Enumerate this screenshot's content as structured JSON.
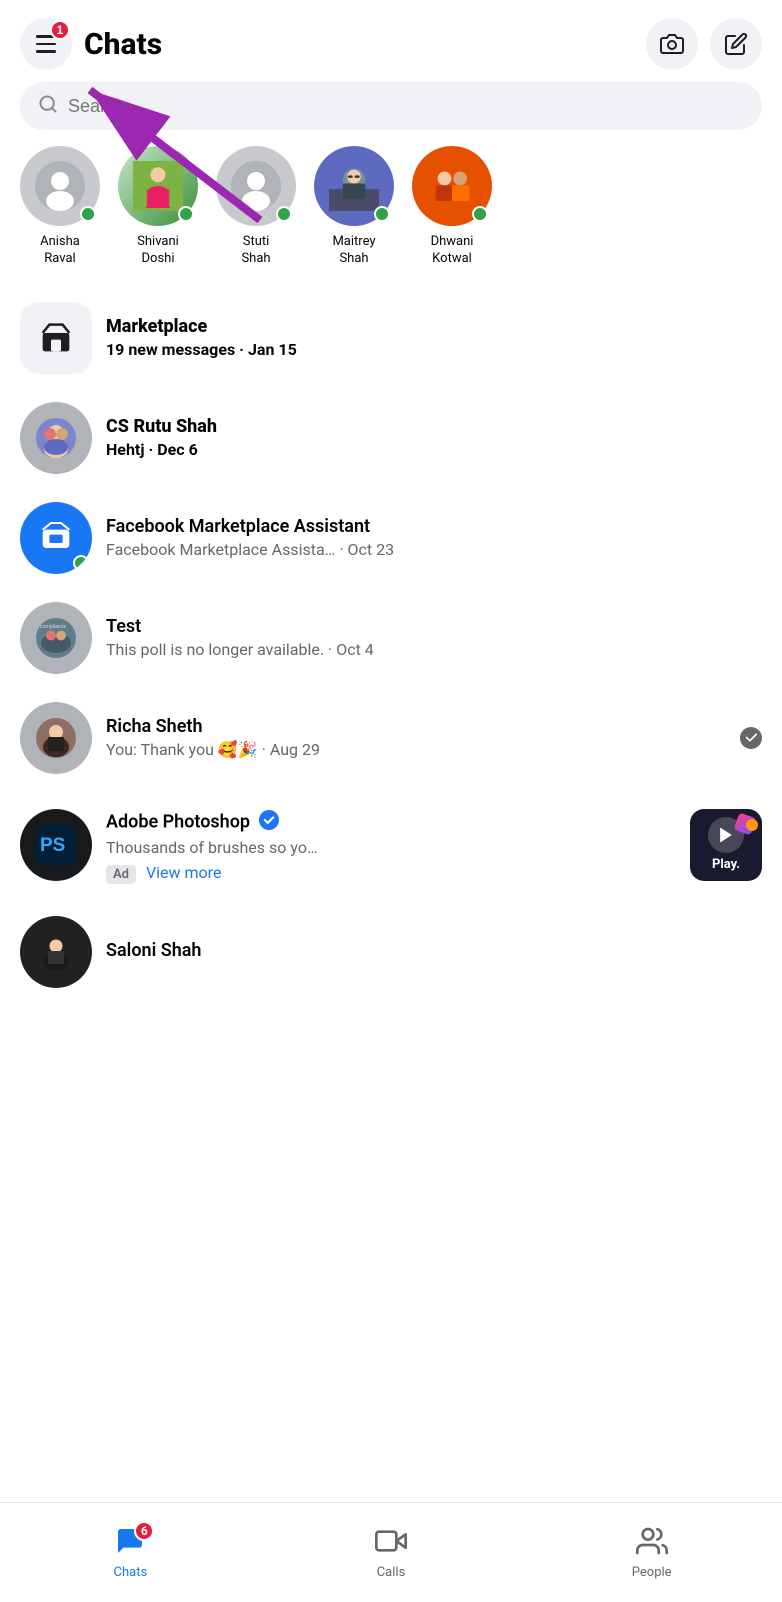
{
  "header": {
    "title": "Chats",
    "menu_badge": "1",
    "camera_aria": "Camera",
    "compose_aria": "Compose"
  },
  "search": {
    "placeholder": "Search"
  },
  "stories": [
    {
      "id": "anisha",
      "name": "Anisha\nRaval",
      "online": true,
      "hasPhoto": false
    },
    {
      "id": "shivani",
      "name": "Shivani\nDoshi",
      "online": true,
      "hasPhoto": true
    },
    {
      "id": "stuti",
      "name": "Stuti\nShah",
      "online": true,
      "hasPhoto": false
    },
    {
      "id": "maitrey",
      "name": "Maitrey\nShah",
      "online": true,
      "hasPhoto": true
    },
    {
      "id": "dhwani",
      "name": "Dhwani\nKotwal",
      "online": true,
      "hasPhoto": true
    }
  ],
  "chats": [
    {
      "id": "marketplace",
      "name": "Marketplace",
      "preview": "19 new messages",
      "time": "Jan 15",
      "isMarketplace": true,
      "bold": true
    },
    {
      "id": "cs-rutu-shah",
      "name": "CS Rutu Shah",
      "preview": "Hehtj · Dec 6",
      "time": "",
      "bold": true
    },
    {
      "id": "fb-marketplace-assistant",
      "name": "Facebook Marketplace Assistant",
      "preview": "Facebook Marketplace Assista… · Oct 23",
      "time": "",
      "online": true,
      "isFBMP": true
    },
    {
      "id": "test",
      "name": "Test",
      "preview": "This poll is no longer available. · Oct 4",
      "time": ""
    },
    {
      "id": "richa-sheth",
      "name": "Richa Sheth",
      "preview": "You: Thank you 🥰🎉 · Aug 29",
      "time": "",
      "hasReadReceipt": true
    },
    {
      "id": "adobe-photoshop",
      "name": "Adobe Photoshop",
      "preview": "Thousands of brushes so yo…",
      "time": "",
      "isAd": true,
      "adLink": "View more",
      "verified": true
    },
    {
      "id": "saloni-shah",
      "name": "Saloni Shah",
      "preview": "",
      "time": ""
    }
  ],
  "bottomNav": [
    {
      "id": "chats",
      "label": "Chats",
      "active": true,
      "badge": "6"
    },
    {
      "id": "calls",
      "label": "Calls",
      "active": false,
      "badge": ""
    },
    {
      "id": "people",
      "label": "People",
      "active": false,
      "badge": ""
    }
  ],
  "arrow": {
    "visible": true
  }
}
